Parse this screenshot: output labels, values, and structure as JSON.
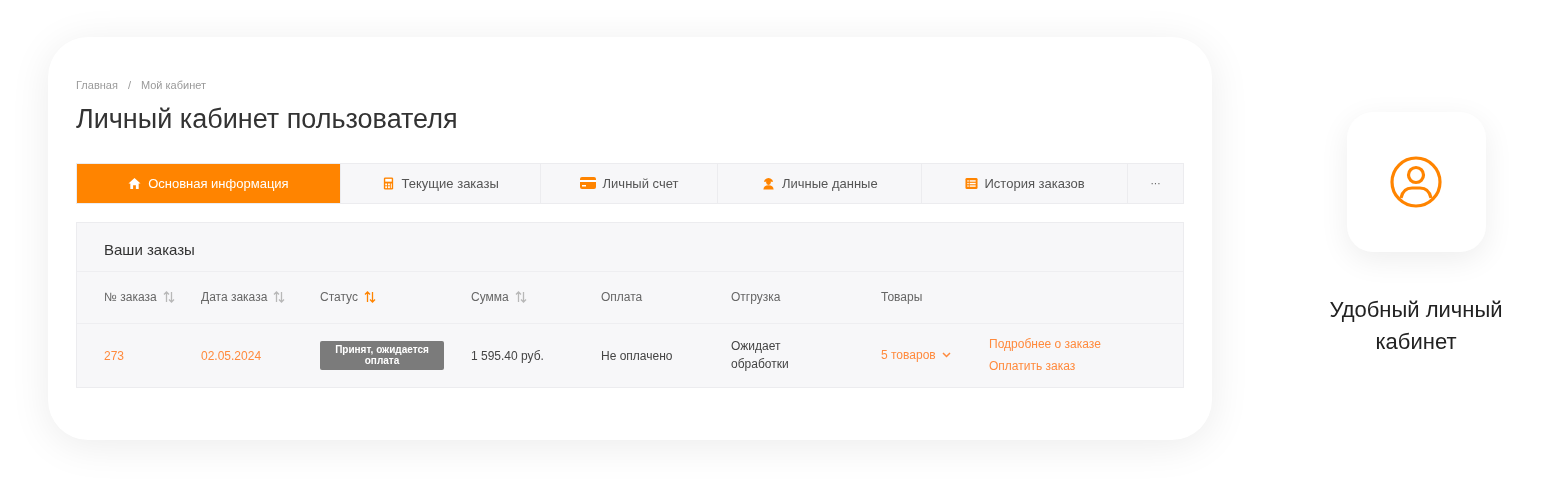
{
  "breadcrumbs": [
    {
      "label": "Главная"
    },
    {
      "label": "Мой кабинет"
    }
  ],
  "breadcrumb_separator": "/",
  "title": "Личный кабинет пользователя",
  "tabs": [
    {
      "label": "Основная информация",
      "selected": true
    },
    {
      "label": "Текущие заказы",
      "selected": false
    },
    {
      "label": "Личный счет",
      "selected": false
    },
    {
      "label": "Личные данные",
      "selected": false
    },
    {
      "label": "История заказов",
      "selected": false
    },
    {
      "label": "···",
      "selected": false
    }
  ],
  "orders": {
    "title": "Ваши заказы",
    "columns": [
      {
        "label": "№ заказа",
        "kind": "sortable",
        "sorted": false
      },
      {
        "label": "Дата заказа",
        "kind": "sortable",
        "sorted": false
      },
      {
        "label": "Статус",
        "kind": "sortable",
        "sorted": true
      },
      {
        "label": "Сумма",
        "kind": "sortable",
        "sorted": false
      },
      {
        "label": "Оплата",
        "kind": "plain"
      },
      {
        "label": "Отгрузка",
        "kind": "plain"
      },
      {
        "label": "Товары",
        "kind": "plain"
      }
    ],
    "rows": [
      {
        "number": "273",
        "date": "02.05.2024",
        "status": "Принят, ожидается оплата",
        "sum": "1 595.40 руб.",
        "payment": "Не оплачено",
        "shipment": "Ожидает обработки",
        "goods": "5 товаров",
        "actions": [
          "Подробнее о заказе",
          "Оплатить заказ"
        ]
      }
    ]
  },
  "feature": {
    "caption": "Удобный личный кабинет"
  }
}
